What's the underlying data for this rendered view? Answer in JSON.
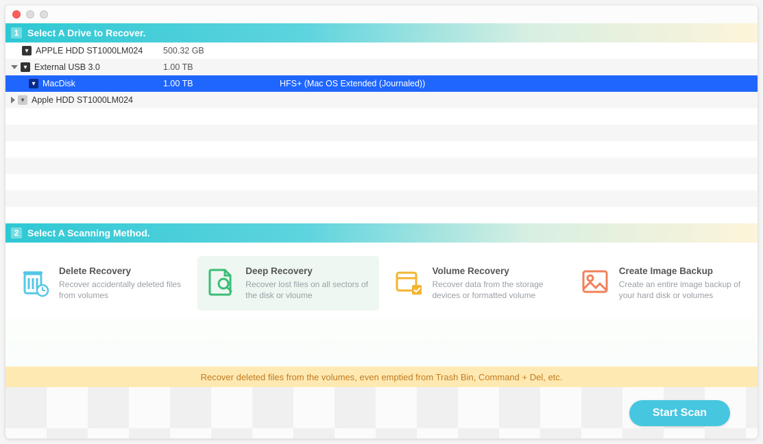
{
  "step1": {
    "num": "1",
    "title": "Select A Drive to Recover."
  },
  "step2": {
    "num": "2",
    "title": "Select A Scanning Method."
  },
  "drives": [
    {
      "name": "APPLE HDD ST1000LM024",
      "size": "500.32 GB",
      "fs": ""
    },
    {
      "name": "External USB 3.0",
      "size": "1.00 TB",
      "fs": ""
    },
    {
      "name": "MacDisk",
      "size": "1.00 TB",
      "fs": "HFS+ (Mac OS Extended (Journaled))"
    },
    {
      "name": "Apple HDD ST1000LM024",
      "size": "",
      "fs": ""
    }
  ],
  "methods": [
    {
      "title": "Delete Recovery",
      "desc": "Recover accidentally deleted files from volumes"
    },
    {
      "title": "Deep Recovery",
      "desc": "Recover lost files on all sectors of the disk or vloume"
    },
    {
      "title": "Volume Recovery",
      "desc": "Recover data from the storage devices or formatted volume"
    },
    {
      "title": "Create Image Backup",
      "desc": "Create an entire image backup of your hard disk or volumes"
    }
  ],
  "info_text": "Recover deleted files from the volumes, even emptied from Trash Bin, Command + Del, etc.",
  "start_label": "Start Scan"
}
